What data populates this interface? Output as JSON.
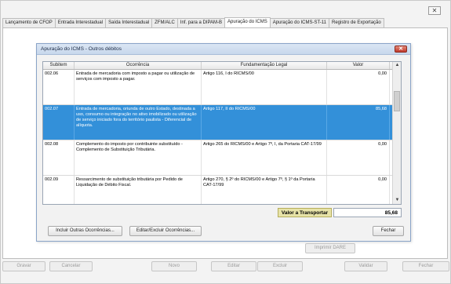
{
  "outer": {
    "close_label": "✕"
  },
  "tabs": [
    {
      "label": "Lançamento de CFOP",
      "active": false
    },
    {
      "label": "Entrada Interestadual",
      "active": false
    },
    {
      "label": "Saída Interestadual",
      "active": false
    },
    {
      "label": "ZFM/ALC",
      "active": false
    },
    {
      "label": "Inf. para a DIPAM-B",
      "active": false
    },
    {
      "label": "Apuração do ICMS",
      "active": true
    },
    {
      "label": "Apuração do ICMS-ST-11",
      "active": false
    },
    {
      "label": "Registro de Exportação",
      "active": false
    }
  ],
  "dialog": {
    "title": "Apuração do ICMS - Outros débitos",
    "close_label": "✕",
    "columns": [
      "Subitem",
      "Ocorrência",
      "Fundamentação Legal",
      "Valor"
    ],
    "rows": [
      {
        "subitem": "002.06",
        "ocorrencia": "Entrada de mercadoria com imposto a pagar ou utilização de serviços com imposto a pagar.",
        "fundamentacao": "Artigo 116, I do RICMS/00",
        "valor": "0,00",
        "selected": false
      },
      {
        "subitem": "002.07",
        "ocorrencia": "Entrada de mercadoria, oriunda de outro Estado, destinada a uso, consumo ou integração no ativo imobilizado ou utilização de serviço iniciado fora do território paulista - Diferencial de alíquota.",
        "fundamentacao": "Artigo 117, II do RICMS/00",
        "valor": "85,68",
        "selected": true
      },
      {
        "subitem": "002.08",
        "ocorrencia": "Complemento do imposto por contribuinte substituído - Complemento de Substituição Tributária.",
        "fundamentacao": "Artigo 265 do RICMS/00 e Artigo 7º, I, da Portaria CAT-17/99",
        "valor": "0,00",
        "selected": false
      },
      {
        "subitem": "002.09",
        "ocorrencia": "Ressarcimento de substituição tributária por Pedido de Liquidação de Débito Fiscal.",
        "fundamentacao": "Artigo 270, § 2º do RICMS/00 e Artigo 7º, § 1º da Portaria CAT-17/99",
        "valor": "0,00",
        "selected": false
      }
    ],
    "total_label": "Valor a Transportar",
    "total_value": "85,68",
    "buttons": {
      "incluir": "Incluir Outras Ocorrências...",
      "editar": "Editar/Excluir Ocorrências...",
      "fechar": "Fechar"
    }
  },
  "imprimir_dare": "Imprimir DARE",
  "bottom_buttons": [
    "Gravar",
    "Cancelar",
    "Novo",
    "Editar",
    "Excluir",
    "Validar",
    "Fechar"
  ],
  "icons": {
    "scroll_up": "arrow-up-icon",
    "scroll_down": "arrow-down-icon"
  }
}
